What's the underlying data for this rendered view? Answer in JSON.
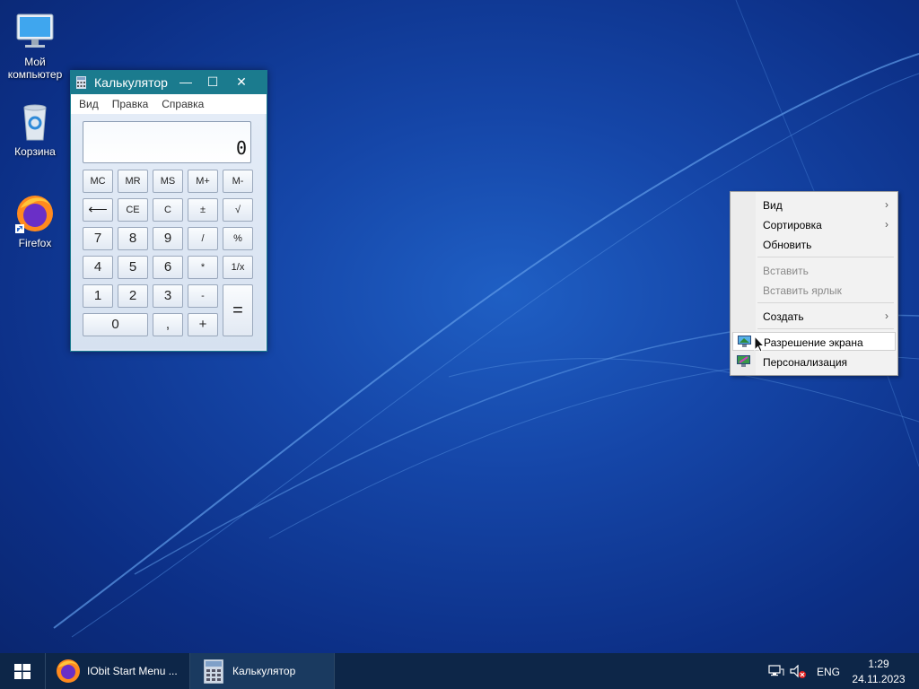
{
  "desktop": {
    "icons": [
      {
        "label_line1": "Мой",
        "label_line2": "компьютер",
        "icon": "computer-icon"
      },
      {
        "label": "Корзина",
        "icon": "recycle-bin-icon"
      },
      {
        "label": "Firefox",
        "icon": "firefox-icon"
      }
    ]
  },
  "calculator": {
    "title": "Калькулятор",
    "icon": "calculator-icon",
    "menu": [
      "Вид",
      "Правка",
      "Справка"
    ],
    "display": "0",
    "buttons": {
      "mc": "MC",
      "mr": "MR",
      "ms": "MS",
      "mplus": "M+",
      "mminus": "M-",
      "backspace": "⟵",
      "ce": "CE",
      "c": "C",
      "plusminus": "±",
      "sqrt": "√",
      "n7": "7",
      "n8": "8",
      "n9": "9",
      "div": "/",
      "percent": "%",
      "n4": "4",
      "n5": "5",
      "n6": "6",
      "mul": "*",
      "recip": "1/x",
      "n1": "1",
      "n2": "2",
      "n3": "3",
      "sub": "-",
      "eq": "=",
      "n0": "0",
      "dot": ",",
      "add": "+"
    }
  },
  "context_menu": {
    "items": [
      {
        "label": "Вид",
        "submenu": true
      },
      {
        "label": "Сортировка",
        "submenu": true
      },
      {
        "label": "Обновить"
      },
      {
        "label": "Вставить",
        "disabled": true
      },
      {
        "label": "Вставить ярлык",
        "disabled": true
      },
      {
        "label": "Создать",
        "submenu": true
      },
      {
        "label": "Разрешение экрана",
        "icon": "display-resolution-icon",
        "highlighted": true
      },
      {
        "label": "Персонализация",
        "icon": "personalization-icon"
      }
    ],
    "arrow": "›"
  },
  "taskbar": {
    "start_icon": "windows-start-icon",
    "items": [
      {
        "label": "IObit Start Menu ...",
        "icon": "firefox-icon"
      },
      {
        "label": "Калькулятор",
        "icon": "calculator-icon"
      }
    ],
    "tray": {
      "network_icon": "network-icon",
      "volume_icon": "volume-muted-icon",
      "language": "ENG",
      "time": "1:29",
      "date": "24.11.2023"
    }
  },
  "colors": {
    "desktop": "#1546a8",
    "calc_title": "#1b7b8e",
    "taskbar": "#0d2648"
  }
}
